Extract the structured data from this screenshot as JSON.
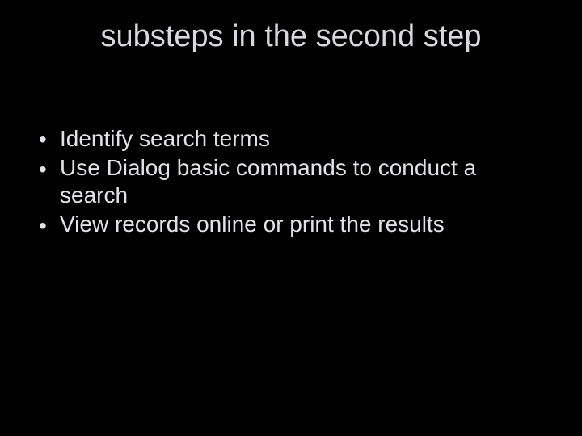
{
  "slide": {
    "title": "substeps in the second step",
    "bullets": [
      "Identify search terms",
      "Use Dialog basic commands to conduct a search",
      "View records online or print the results"
    ]
  }
}
